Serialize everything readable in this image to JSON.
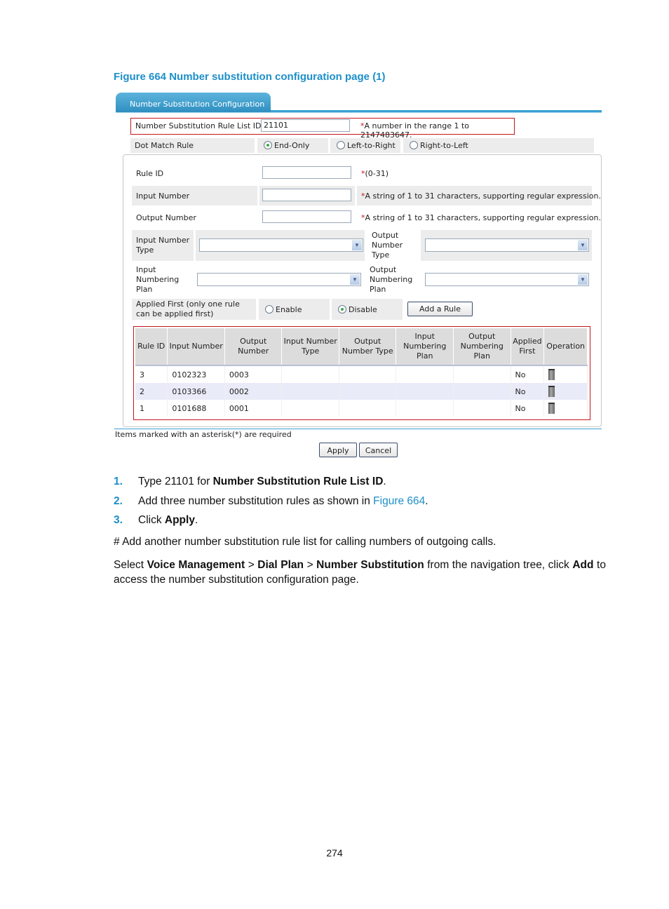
{
  "figure_caption": "Figure 664 Number substitution configuration page (1)",
  "tab": {
    "label": "Number Substitution Configuration"
  },
  "form": {
    "list_id": {
      "label": "Number Substitution Rule List ID",
      "value": "21101",
      "hint_mark": "*",
      "hint": "A number in the range 1 to 2147483647."
    },
    "dot_match": {
      "label": "Dot Match Rule",
      "options": [
        "End-Only",
        "Left-to-Right",
        "Right-to-Left"
      ],
      "selected": "End-Only"
    },
    "rule_id": {
      "label": "Rule ID",
      "value": "",
      "hint_mark": "*",
      "hint": "(0-31)"
    },
    "input_number": {
      "label": "Input Number",
      "value": "",
      "hint_mark": "*",
      "hint": "A string of 1 to 31 characters, supporting regular expression."
    },
    "output_number": {
      "label": "Output Number",
      "value": "",
      "hint_mark": "*",
      "hint": "A string of 1 to 31 characters, supporting regular expression."
    },
    "input_number_type": {
      "label": "Input Number Type",
      "value": ""
    },
    "output_number_type": {
      "label": "Output Number Type",
      "value": ""
    },
    "input_numbering_plan": {
      "label": "Input Numbering Plan",
      "value": ""
    },
    "output_numbering_plan": {
      "label": "Output Numbering Plan",
      "value": ""
    },
    "applied_first": {
      "label": "Applied First (only one rule can be applied first)",
      "options": [
        "Enable",
        "Disable"
      ],
      "selected": "Disable"
    },
    "add_rule_button": "Add a Rule"
  },
  "table": {
    "headers": [
      "Rule ID",
      "Input Number",
      "Output Number",
      "Input Number Type",
      "Output Number Type",
      "Input Numbering Plan",
      "Output Numbering Plan",
      "Applied First",
      "Operation"
    ],
    "rows": [
      {
        "rule_id": "3",
        "input": "0102323",
        "output": "0003",
        "in_type": "",
        "out_type": "",
        "in_plan": "",
        "out_plan": "",
        "applied_first": "No",
        "operation_icon": "trash-icon"
      },
      {
        "rule_id": "2",
        "input": "0103366",
        "output": "0002",
        "in_type": "",
        "out_type": "",
        "in_plan": "",
        "out_plan": "",
        "applied_first": "No",
        "operation_icon": "trash-icon"
      },
      {
        "rule_id": "1",
        "input": "0101688",
        "output": "0001",
        "in_type": "",
        "out_type": "",
        "in_plan": "",
        "out_plan": "",
        "applied_first": "No",
        "operation_icon": "trash-icon"
      }
    ]
  },
  "footer_note": "Items marked with an asterisk(*) are required",
  "buttons": {
    "apply": "Apply",
    "cancel": "Cancel"
  },
  "steps": [
    {
      "num": "1.",
      "pre": "Type 21101 for ",
      "bold": "Number Substitution Rule List ID",
      "post": "."
    },
    {
      "num": "2.",
      "pre": "Add three number substitution rules as shown in ",
      "link": "Figure 664",
      "post": "."
    },
    {
      "num": "3.",
      "pre": "Click ",
      "bold": "Apply",
      "post": "."
    }
  ],
  "para1": "# Add another number substitution rule list for calling numbers of outgoing calls.",
  "para2": {
    "t1": "Select ",
    "b1": "Voice Management",
    "t2": " > ",
    "b2": "Dial Plan",
    "t3": " > ",
    "b3": "Number Substitution",
    "t4": " from the navigation tree, click ",
    "b4": "Add",
    "t5": " to access the number substitution configuration page."
  },
  "page_number": "274",
  "colors": {
    "accent": "#1d8fc9",
    "required": "#c4161c",
    "tab": "#3aa0d2"
  }
}
